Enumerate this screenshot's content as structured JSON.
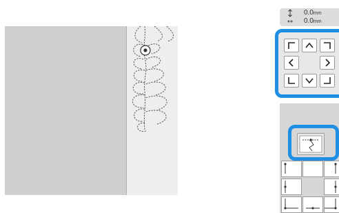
{
  "readout": {
    "vertical_icon": "vertical-arrows-icon",
    "vertical_value": "0.0",
    "vertical_unit": "mm",
    "horizontal_icon": "horizontal-arrows-icon",
    "horizontal_value": "0.0",
    "horizontal_unit": "mm"
  },
  "direction_pad": {
    "highlight_color": "#1f8fe6",
    "buttons": [
      "move-up-left",
      "move-up",
      "move-up-right",
      "move-left",
      "move-right",
      "move-down-left",
      "move-down",
      "move-down-right"
    ]
  },
  "stitch_button": {
    "icon": "stitch-start-point-icon"
  },
  "colors": {
    "highlight": "#1f8fe6",
    "panel_bg": "#d6d6d6",
    "fabric": "#cfcfcf"
  }
}
